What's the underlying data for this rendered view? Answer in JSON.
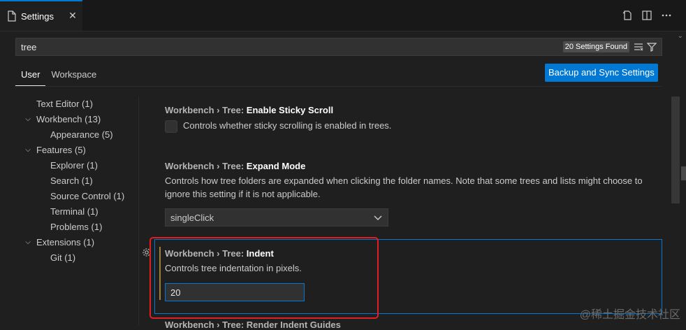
{
  "tab": {
    "label": "Settings",
    "close": "✕"
  },
  "editor_actions": [
    "open-json-icon",
    "split-editor-icon",
    "more-actions-icon"
  ],
  "search": {
    "query": "tree",
    "count_badge": "20 Settings Found"
  },
  "scope_tabs": [
    {
      "label": "User",
      "active": true
    },
    {
      "label": "Workspace",
      "active": false
    }
  ],
  "backup_button": "Backup and Sync Settings",
  "toc": [
    {
      "label": "Text Editor (1)",
      "level": 1,
      "expanded": null
    },
    {
      "label": "Workbench (13)",
      "level": 1,
      "expanded": true
    },
    {
      "label": "Appearance (5)",
      "level": 2,
      "expanded": null
    },
    {
      "label": "Features (5)",
      "level": 1,
      "expanded": true
    },
    {
      "label": "Explorer (1)",
      "level": 2,
      "expanded": null
    },
    {
      "label": "Search (1)",
      "level": 2,
      "expanded": null
    },
    {
      "label": "Source Control (1)",
      "level": 2,
      "expanded": null
    },
    {
      "label": "Terminal (1)",
      "level": 2,
      "expanded": null
    },
    {
      "label": "Problems (1)",
      "level": 2,
      "expanded": null
    },
    {
      "label": "Extensions (1)",
      "level": 1,
      "expanded": true
    },
    {
      "label": "Git (1)",
      "level": 2,
      "expanded": null
    }
  ],
  "settings": {
    "sticky": {
      "category": "Workbench › Tree: ",
      "key": "Enable Sticky Scroll",
      "description": "Controls whether sticky scrolling is enabled in trees."
    },
    "expand": {
      "category": "Workbench › Tree: ",
      "key": "Expand Mode",
      "description": "Controls how tree folders are expanded when clicking the folder names. Note that some trees and lists might choose to ignore this setting if it is not applicable.",
      "value": "singleClick"
    },
    "indent": {
      "category": "Workbench › Tree: ",
      "key": "Indent",
      "description": "Controls tree indentation in pixels.",
      "value": "20"
    },
    "next": {
      "text": "Workbench › Tree: Render Indent Guides"
    }
  },
  "watermark": "@稀土掘金技术社区",
  "colors": {
    "accent": "#0078d4",
    "annotation": "#e01e24",
    "modified": "#9e7f3b"
  }
}
